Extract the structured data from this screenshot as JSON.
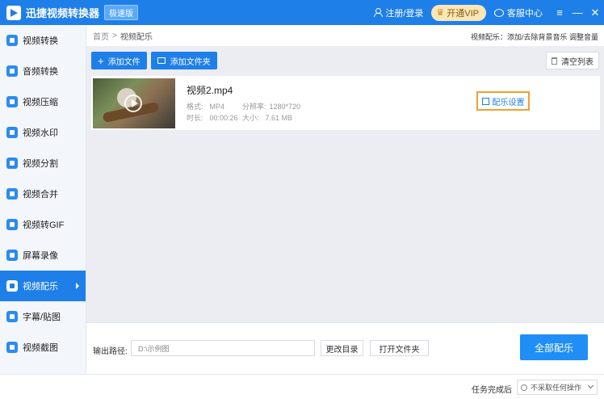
{
  "titlebar": {
    "app_title": "迅捷视频转换器",
    "edition": "极速版",
    "login": "注册/登录",
    "vip": "开通VIP",
    "support": "客服中心",
    "menu_icon": "≡",
    "minimize": "—",
    "close": "✕"
  },
  "sidebar": {
    "items": [
      {
        "label": "视频转换"
      },
      {
        "label": "音频转换"
      },
      {
        "label": "视频压缩"
      },
      {
        "label": "视频水印"
      },
      {
        "label": "视频分割"
      },
      {
        "label": "视频合并"
      },
      {
        "label": "视频转GIF"
      },
      {
        "label": "屏幕录像"
      },
      {
        "label": "视频配乐"
      },
      {
        "label": "字幕/贴图"
      },
      {
        "label": "视频截图"
      }
    ],
    "active_index": 8
  },
  "breadcrumb": {
    "home": "首页",
    "separator": ">",
    "current": "视频配乐",
    "hint": "视频配乐：添加/去除背景音乐 调整音量"
  },
  "toolbar": {
    "add_file": "添加文件",
    "add_folder": "添加文件夹",
    "clear_list": "清空列表"
  },
  "file": {
    "name": "视频2.mp4",
    "format_label": "格式:",
    "format": "MP4",
    "resolution_label": "分辨率:",
    "resolution": "1280*720",
    "duration_label": "时长:",
    "duration": "00:00:26",
    "size_label": "大小:",
    "size": "7.61 MB",
    "music_settings": "配乐设置"
  },
  "output": {
    "label": "输出路径:",
    "path": "D:\\示例图",
    "change_dir": "更改目录",
    "open_folder": "打开文件夹",
    "convert_all": "全部配乐"
  },
  "status": {
    "after_label": "任务完成后",
    "after_value": "不采取任何操作"
  },
  "colors": {
    "brand_blue": "#1f7fe8",
    "highlight_orange": "#f0a030",
    "vip_gold": "#fbe6b5"
  }
}
